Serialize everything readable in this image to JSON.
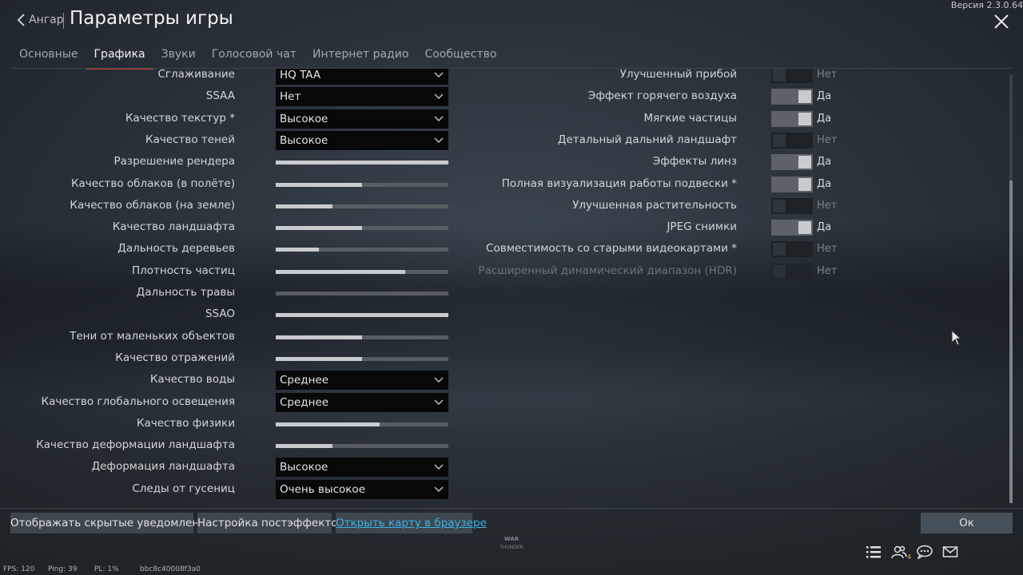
{
  "header": {
    "back_label": "Ангар",
    "title": "Параметры игры",
    "version": "Версия 2.3.0.64"
  },
  "tabs": [
    {
      "label": "Основные"
    },
    {
      "label": "Графика",
      "active": true
    },
    {
      "label": "Звуки"
    },
    {
      "label": "Голосовой чат"
    },
    {
      "label": "Интернет радио"
    },
    {
      "label": "Сообщество"
    }
  ],
  "left_settings": [
    {
      "label": "Сглаживание",
      "type": "select",
      "value": "HQ TAA",
      "clipped": true
    },
    {
      "label": "SSAA",
      "type": "select",
      "value": "Нет"
    },
    {
      "label": "Качество текстур *",
      "type": "select",
      "value": "Высокое"
    },
    {
      "label": "Качество теней",
      "type": "select",
      "value": "Высокое"
    },
    {
      "label": "Разрешение рендера",
      "type": "slider",
      "level": 1.0
    },
    {
      "label": "Качество облаков (в полёте)",
      "type": "slider",
      "level": 0.5
    },
    {
      "label": "Качество облаков (на земле)",
      "type": "slider",
      "level": 0.33
    },
    {
      "label": "Качество ландшафта",
      "type": "slider",
      "level": 0.5
    },
    {
      "label": "Дальность деревьев",
      "type": "slider",
      "level": 0.25
    },
    {
      "label": "Плотность частиц",
      "type": "slider",
      "level": 0.75
    },
    {
      "label": "Дальность травы",
      "type": "slider",
      "level": 0.0
    },
    {
      "label": "SSAO",
      "type": "slider",
      "level": 1.0
    },
    {
      "label": "Тени от маленьких объектов",
      "type": "slider",
      "level": 0.5
    },
    {
      "label": "Качество отражений",
      "type": "slider",
      "level": 0.5
    },
    {
      "label": "Качество воды",
      "type": "select",
      "value": "Среднее"
    },
    {
      "label": "Качество глобального освещения",
      "type": "select",
      "value": "Среднее"
    },
    {
      "label": "Качество физики",
      "type": "slider",
      "level": 0.6
    },
    {
      "label": "Качество деформации ландшафта",
      "type": "slider",
      "level": 0.33
    },
    {
      "label": "Деформация ландшафта",
      "type": "select",
      "value": "Высокое"
    },
    {
      "label": "Следы от гусениц",
      "type": "select",
      "value": "Очень высокое"
    }
  ],
  "right_settings": [
    {
      "label": "Улучшенный прибой",
      "state": "Нет",
      "on": false,
      "clipped": true
    },
    {
      "label": "Эффект горячего воздуха",
      "state": "Да",
      "on": true
    },
    {
      "label": "Мягкие частицы",
      "state": "Да",
      "on": true
    },
    {
      "label": "Детальный дальний ландшафт",
      "state": "Нет",
      "on": false
    },
    {
      "label": "Эффекты линз",
      "state": "Да",
      "on": true
    },
    {
      "label": "Полная визуализация работы подвески *",
      "state": "Да",
      "on": true
    },
    {
      "label": "Улучшенная растительность",
      "state": "Нет",
      "on": false
    },
    {
      "label": "JPEG снимки",
      "state": "Да",
      "on": true
    },
    {
      "label": "Совместимость со старыми видеокартами *",
      "state": "Нет",
      "on": false
    },
    {
      "label": "Расширенный динамический диапазон (HDR)",
      "state": "Нет",
      "on": false,
      "disabled": true
    }
  ],
  "buttons": {
    "hidden_notifications": "Отображать скрытые уведомления",
    "postfx": "Настройка постэффектов",
    "open_map": "Открыть карту в браузере",
    "ok": "Ок"
  },
  "logo_text": "WAR THUNDER",
  "status": {
    "fps": "FPS: 120",
    "ping": "Ping: 39",
    "pl": "PL: 1%",
    "hash": "bbc8c40008f3a0"
  },
  "squad_badge": "4",
  "icons": [
    "list-icon",
    "squad-icon",
    "chat-icon",
    "mail-icon"
  ]
}
